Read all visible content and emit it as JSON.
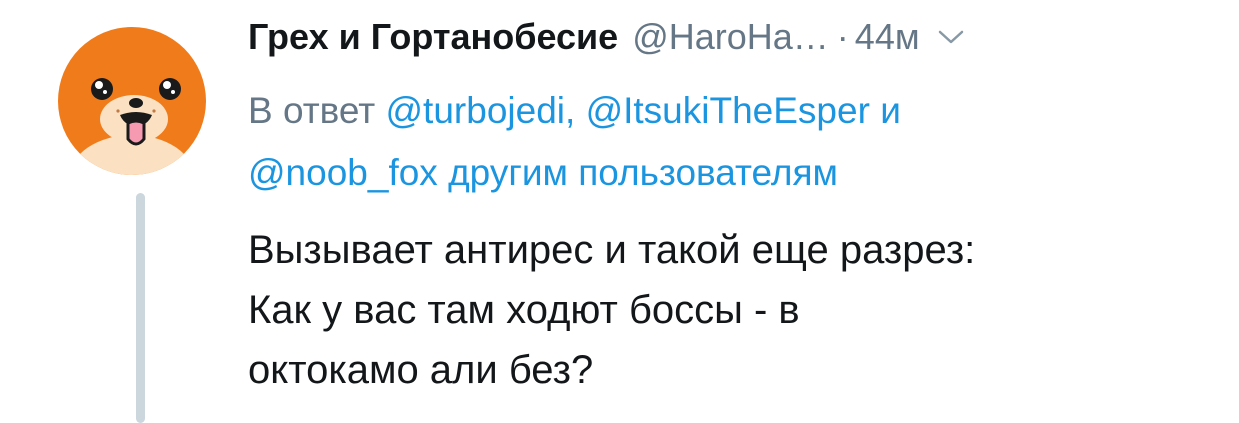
{
  "author": {
    "name": "Грех и Гортанобесие",
    "handle": "@HaroHa…",
    "separator": "·",
    "time": "44м"
  },
  "reply": {
    "prefix": "В ответ",
    "mentions": [
      "@turbojedi",
      "@ItsukiTheEsper"
    ],
    "comma": ",",
    "conjunction": "и",
    "last_mention": "@noob_fox",
    "suffix": "другим пользователям"
  },
  "tweet": {
    "lines": [
      "Вызывает антирес и такой еще разрез:",
      "Как у вас там ходют боссы - в",
      "октокамо али без?"
    ]
  },
  "colors": {
    "avatar_bg": "#f07b1b",
    "mention": "#1b95e0",
    "secondary_text": "#657786",
    "thread_line": "#ccd6dd"
  },
  "icons": {
    "avatar": "fox-face-avatar",
    "menu": "chevron-down-icon"
  }
}
